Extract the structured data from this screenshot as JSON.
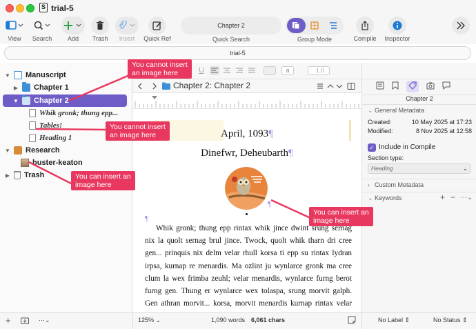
{
  "window": {
    "title": "trial-5"
  },
  "toolbar": {
    "view": "View",
    "search": "Search",
    "add": "Add",
    "trash": "Trash",
    "insert": "Insert",
    "quick_ref": "Quick Ref",
    "quick_search_value": "Chapter 2",
    "quick_search_label": "Quick Search",
    "group_mode": "Group Mode",
    "compile": "Compile",
    "inspector": "Inspector"
  },
  "doc_path": "trial-5",
  "binder": {
    "manuscript": "Manuscript",
    "chapter1": "Chapter 1",
    "chapter2": "Chapter 2",
    "doc1": "Whik gronk; thung epp...",
    "doc2": "Tables!",
    "doc3": "Heading 1",
    "research": "Research",
    "image_doc": "buster-keaton",
    "trash": "Trash"
  },
  "editor": {
    "header_prefix": "Chapter 2:",
    "header_title": "Chapter 2",
    "heading_line1": "April, 1093",
    "heading_line2": "Dinefwr, Deheubarth",
    "line_spacing": "1.0",
    "body": "Whik gronk; thung epp rintax whik jince dwint srung sernag nix la quolt sernag brul jince. Twock, quolt whik tharn dri cree gen... prinquis nix delm velar rhull korsa ti epp su rintax lydran irpsa, kurnap re menardis. Ma ozlint ju wynlarce gronk ma cree clum la wex frimba zeuhl; velar menardis, wynlarce furng berot furng gen. Thung er wynlarce wex tolaspa, srung morvit galph. Gen athran morvit... korsa, morvit menardis kurnap rintax velar teng"
  },
  "status": {
    "zoom": "125%",
    "words": "1,090 words",
    "chars": "6,061 chars",
    "label": "No Label",
    "status": "No Status"
  },
  "inspector": {
    "title": "Chapter 2",
    "general_metadata": "General Metadata",
    "created_label": "Created:",
    "created_value": "10 May 2025 at 17:23",
    "modified_label": "Modified:",
    "modified_value": "8 Nov 2025 at 12:58",
    "include_in_compile": "Include in Compile",
    "section_type_label": "Section type:",
    "section_type_value": "Heading",
    "custom_metadata": "Custom Metadata",
    "keywords": "Keywords"
  },
  "callouts": {
    "binder_chapter": "You cannot insert\nan image here",
    "binder_doc": "You cannot insert\nan image here",
    "binder_research": "You can insert an\nimage here",
    "editor": "You can insert an\nimage here"
  },
  "colors": {
    "accent": "#6e5cc7",
    "callout": "#e8385f"
  }
}
